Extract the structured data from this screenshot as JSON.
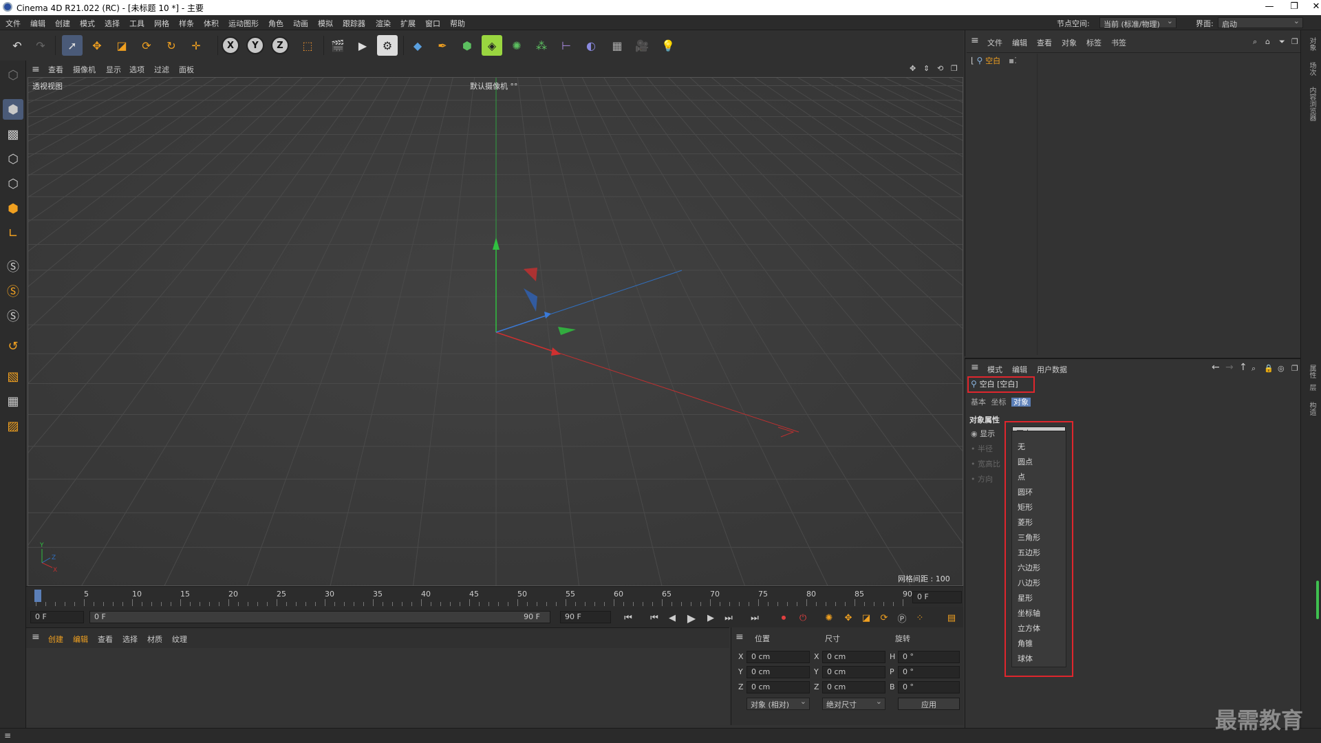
{
  "window": {
    "title": "Cinema 4D R21.022 (RC) - [未标题 10 *] - 主要",
    "min": "—",
    "max": "❐",
    "close": "✕"
  },
  "menubar": {
    "items": [
      "文件",
      "编辑",
      "创建",
      "模式",
      "选择",
      "工具",
      "网格",
      "样条",
      "体积",
      "运动图形",
      "角色",
      "动画",
      "模拟",
      "跟踪器",
      "渲染",
      "扩展",
      "窗口",
      "帮助"
    ],
    "node_space_label": "节点空间:",
    "node_space_value": "当前 (标准/物理)",
    "interface_label": "界面:",
    "interface_value": "启动"
  },
  "viewport": {
    "menu": [
      "查看",
      "摄像机",
      "显示",
      "选项",
      "过滤",
      "面板"
    ],
    "name": "透视视图",
    "camera": "默认摄像机 °°",
    "grid_info": "网格间距 : 100 cm"
  },
  "timeline": {
    "ticks": [
      "0",
      "5",
      "10",
      "15",
      "20",
      "25",
      "30",
      "35",
      "40",
      "45",
      "50",
      "55",
      "60",
      "65",
      "70",
      "75",
      "80",
      "85",
      "90"
    ],
    "current_frame": "0 F"
  },
  "playbar": {
    "start": "0 F",
    "range_start": "0 F",
    "range_end": "90 F",
    "end": "90 F"
  },
  "material_manager": {
    "menu": [
      "创建",
      "编辑",
      "查看",
      "选择",
      "材质",
      "纹理"
    ]
  },
  "coords": {
    "headers": [
      "位置",
      "尺寸",
      "旋转"
    ],
    "rows": [
      {
        "axis": "X",
        "pos": "0 cm",
        "size_axis": "X",
        "size": "0 cm",
        "rot_axis": "H",
        "rot": "0 °"
      },
      {
        "axis": "Y",
        "pos": "0 cm",
        "size_axis": "Y",
        "size": "0 cm",
        "rot_axis": "P",
        "rot": "0 °"
      },
      {
        "axis": "Z",
        "pos": "0 cm",
        "size_axis": "Z",
        "size": "0 cm",
        "rot_axis": "B",
        "rot": "0 °"
      }
    ],
    "mode": "对象 (相对)",
    "size_mode": "绝对尺寸",
    "apply": "应用"
  },
  "object_manager": {
    "menu": [
      "文件",
      "编辑",
      "查看",
      "对象",
      "标签",
      "书签"
    ],
    "object_name": "空白"
  },
  "attribute_manager": {
    "menu": [
      "模式",
      "编辑",
      "用户数据"
    ],
    "title": "空白 [空白]",
    "tabs": [
      "基本",
      "坐标",
      "对象"
    ],
    "section": "对象属性",
    "fields": [
      "显示",
      "半径",
      "宽高比",
      "方向"
    ],
    "display_value": "圆点",
    "dropdown_options": [
      "无",
      "圆点",
      "点",
      "圆环",
      "矩形",
      "菱形",
      "三角形",
      "五边形",
      "六边形",
      "八边形",
      "星形",
      "坐标轴",
      "立方体",
      "角锥",
      "球体"
    ]
  },
  "side_tabs": [
    "对象",
    "场次",
    "内容浏览器",
    "属性",
    "层",
    "构造"
  ],
  "watermark": "最需教育"
}
